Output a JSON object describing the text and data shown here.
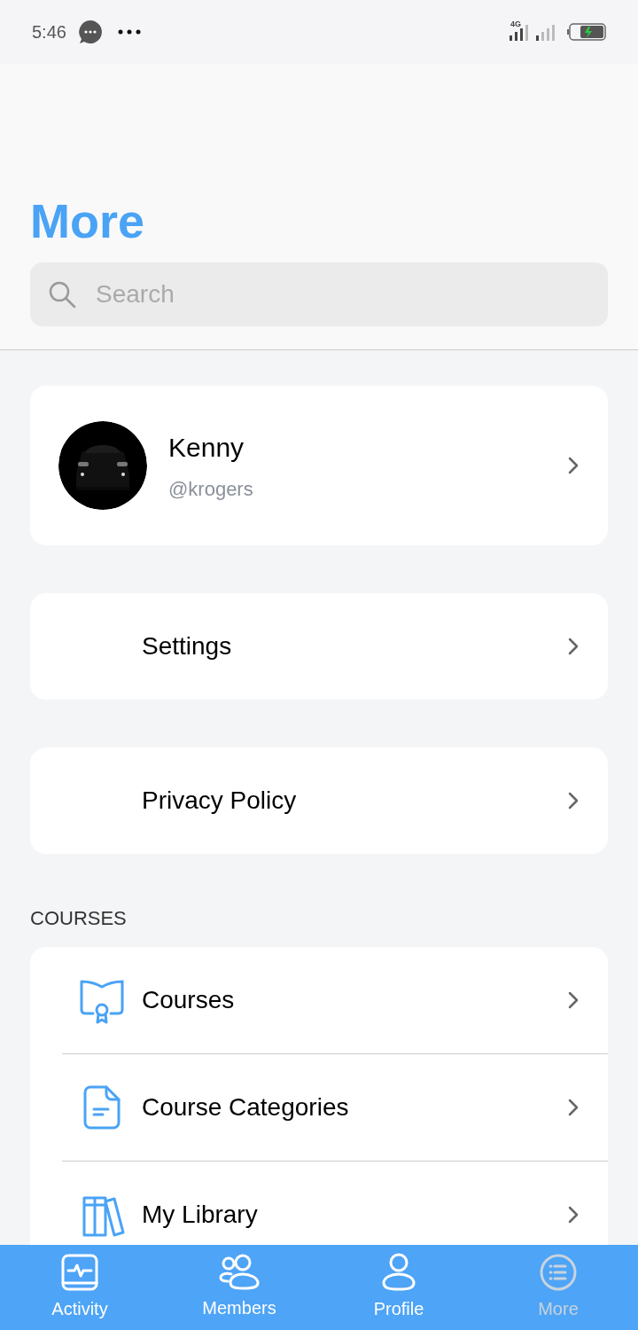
{
  "status_bar": {
    "time": "5:46",
    "network": "4G"
  },
  "header": {
    "title": "More",
    "search": {
      "placeholder": "Search"
    }
  },
  "profile": {
    "name": "Kenny",
    "handle": "@krogers"
  },
  "links": [
    {
      "label": "Settings"
    },
    {
      "label": "Privacy Policy"
    }
  ],
  "courses_section": {
    "heading": "COURSES",
    "items": [
      {
        "label": "Courses"
      },
      {
        "label": "Course Categories"
      },
      {
        "label": "My Library"
      }
    ]
  },
  "tab_bar": [
    {
      "label": "Activity",
      "selected": false
    },
    {
      "label": "Members",
      "selected": false
    },
    {
      "label": "Profile",
      "selected": false
    },
    {
      "label": "More",
      "selected": true
    }
  ]
}
